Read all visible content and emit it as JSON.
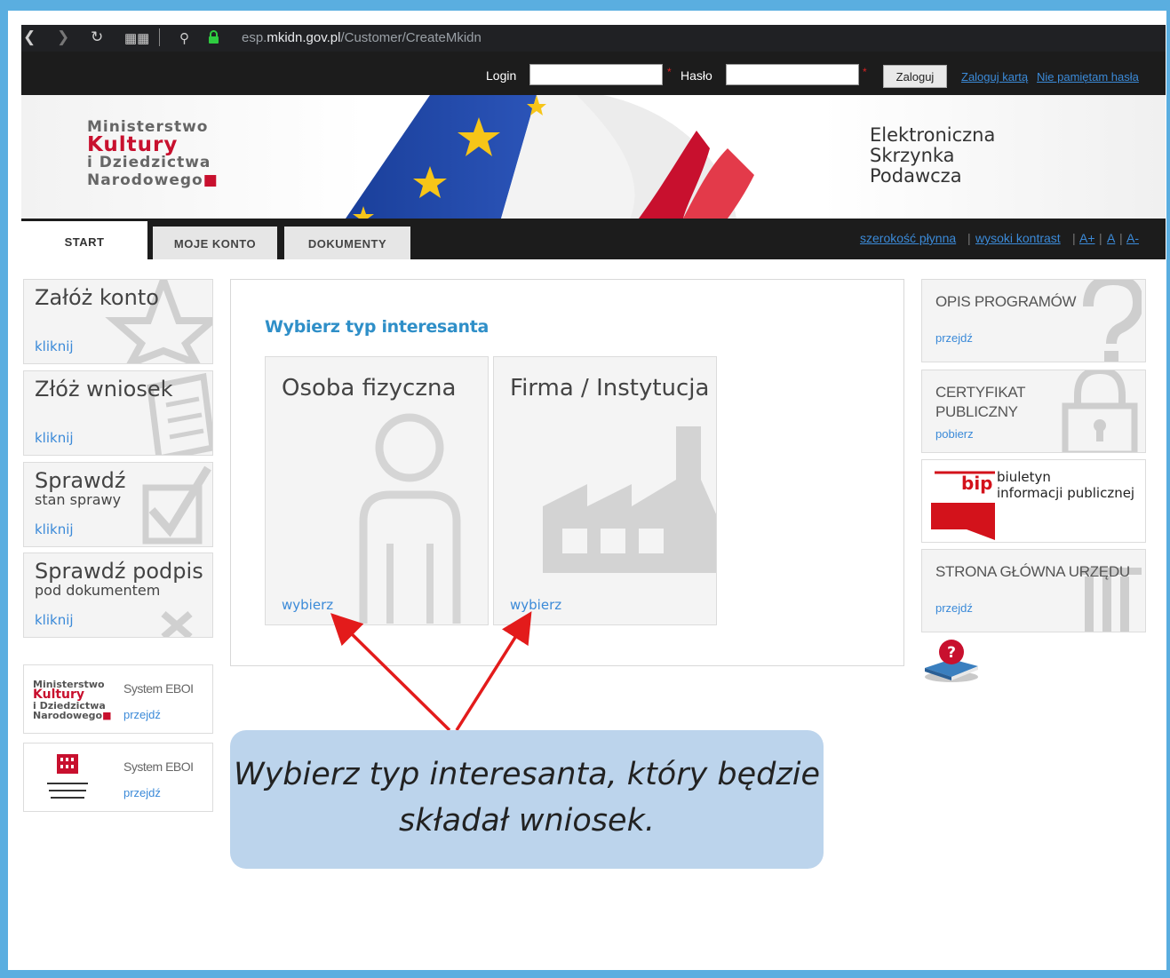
{
  "browser": {
    "url_prefix": "esp.",
    "url_domain": "mkidn.gov.pl",
    "url_path": "/Customer/CreateMkidn"
  },
  "login": {
    "login_label": "Login",
    "password_label": "Hasło",
    "login_button": "Zaloguj",
    "card_login_link": "Zaloguj kartą",
    "forgot_password_link": "Nie pamiętam hasła"
  },
  "banner": {
    "logo": [
      "Ministerstwo",
      "Kultury",
      "i Dziedzictwa",
      "Narodowego"
    ],
    "title_lines": [
      "Elektroniczna",
      "Skrzynka",
      "Podawcza"
    ]
  },
  "tabs": [
    "START",
    "MOJE KONTO",
    "DOKUMENTY"
  ],
  "accessibility": {
    "fluid_width": "szerokość płynna",
    "high_contrast": "wysoki kontrast",
    "font_up": "A+",
    "font_normal": "A",
    "font_down": "A-"
  },
  "left_tiles": [
    {
      "title": "Załóż konto",
      "subtitle": "",
      "link": "kliknij"
    },
    {
      "title": "Złóż wniosek",
      "subtitle": "",
      "link": "kliknij"
    },
    {
      "title": "Sprawdź",
      "subtitle": "stan sprawy",
      "link": "kliknij"
    },
    {
      "title": "Sprawdź podpis",
      "subtitle": "pod dokumentem",
      "link": "kliknij"
    }
  ],
  "system_tiles": [
    {
      "label": "System EBOI",
      "link": "przejdź"
    },
    {
      "label": "System EBOI",
      "link": "przejdź"
    }
  ],
  "center": {
    "title": "Wybierz typ interesanta",
    "options": [
      {
        "title": "Osoba fizyczna",
        "link": "wybierz"
      },
      {
        "title": "Firma / Instytucja",
        "link": "wybierz"
      }
    ]
  },
  "right_tiles": {
    "programs": {
      "title": "OPIS PROGRAMÓW",
      "link": "przejdź"
    },
    "certificate": {
      "title_line1": "CERTYFIKAT",
      "title_line2": "PUBLICZNY",
      "link": "pobierz"
    },
    "bip": {
      "logo": "bip",
      "line1": "biuletyn",
      "line2": "informacji publicznej"
    },
    "homepage": {
      "title": "STRONA GŁÓWNA URZĘDU",
      "link": "przejdź"
    }
  },
  "callout": {
    "line1": "Wybierz typ interesanta, który będzie",
    "line2": "składał wniosek."
  },
  "colors": {
    "frame": "#5aaee0",
    "link": "#3b8ad8",
    "heading": "#2f8fc8",
    "callout": "#bcd4ec",
    "arrow": "#e31b1b"
  }
}
